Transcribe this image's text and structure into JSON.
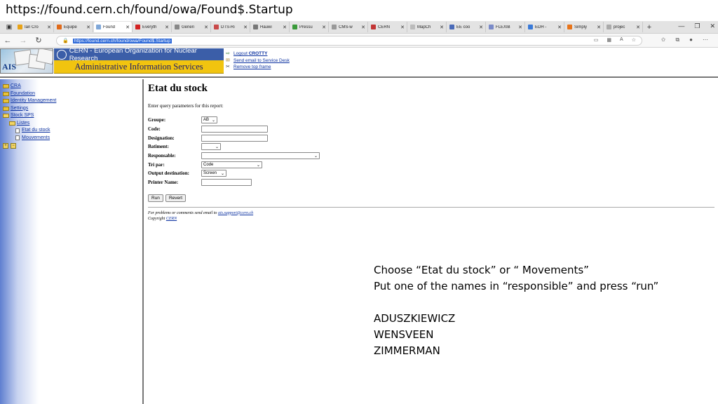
{
  "slide": {
    "url_caption": "https://found.cern.ch/found/owa/Found$.Startup"
  },
  "browser": {
    "tabs": [
      {
        "label": "Ian Cro",
        "color": "#e8a317"
      },
      {
        "label": "Equipe",
        "color": "#e06a1a"
      },
      {
        "label": "Found",
        "color": "#7fa7d8",
        "active": true
      },
      {
        "label": "Everyth",
        "color": "#d32222"
      },
      {
        "label": "Generi",
        "color": "#888888"
      },
      {
        "label": "DTS-Ri",
        "color": "#c94a4a"
      },
      {
        "label": "Hauwi",
        "color": "#777777"
      },
      {
        "label": "Pressu",
        "color": "#3a9a3a"
      },
      {
        "label": "CMS-w",
        "color": "#999999"
      },
      {
        "label": "CERN",
        "color": "#c23535"
      },
      {
        "label": "MapCh",
        "color": "#bbbbbb"
      },
      {
        "label": "EE coo",
        "color": "#4a6ab8"
      },
      {
        "label": "FLEXIB",
        "color": "#7a8ac8"
      },
      {
        "label": "EDH -",
        "color": "#3a7ad8"
      },
      {
        "label": "Simply",
        "color": "#e8741a"
      },
      {
        "label": "projec",
        "color": "#aaaaaa"
      }
    ],
    "address": "https://found.cern.ch/found/owa/Found$.Startup"
  },
  "header": {
    "ais_logo_text": "AIS",
    "cern_title": "CERN - European Organization for Nuclear Research",
    "ais_title": "Administrative Information Services",
    "logout_prefix": "Logout",
    "logout_user": "CROTTY",
    "send_email": "Send email to Service Desk",
    "remove_frame": "Remove top frame"
  },
  "nav": {
    "cra": "CRA",
    "foundation": "Foundation",
    "identity": "Identity Management",
    "settings": "Settings",
    "stock": "Stock SPS",
    "listes": "Listes",
    "etat": "Etat du stock",
    "mouvements": "Mouvements"
  },
  "form": {
    "title": "Etat du stock",
    "intro": "Enter query parameters for this report:",
    "groupe_label": "Groupe:",
    "groupe_value": "AB",
    "code_label": "Code:",
    "designation_label": "Designation:",
    "batiment_label": "Batiment:",
    "responsable_label": "Responsable:",
    "tri_label": "Tri par:",
    "tri_value": "Code",
    "output_label": "Output destination:",
    "output_value": "Screen",
    "printer_label": "Printer Name:",
    "run": "Run",
    "revert": "Revert",
    "footer_text": "For problems or comments send email to",
    "footer_email": "ais.support@cern.ch",
    "copyright": "Copyright",
    "copyright_link": "CERN"
  },
  "notes": {
    "line1": "Choose “Etat du stock” or “ Movements”",
    "line2": "Put one of the names in “responsible” and press “run”",
    "names": [
      "ADUSZKIEWICZ",
      "WENSVEEN",
      "ZIMMERMAN"
    ]
  }
}
